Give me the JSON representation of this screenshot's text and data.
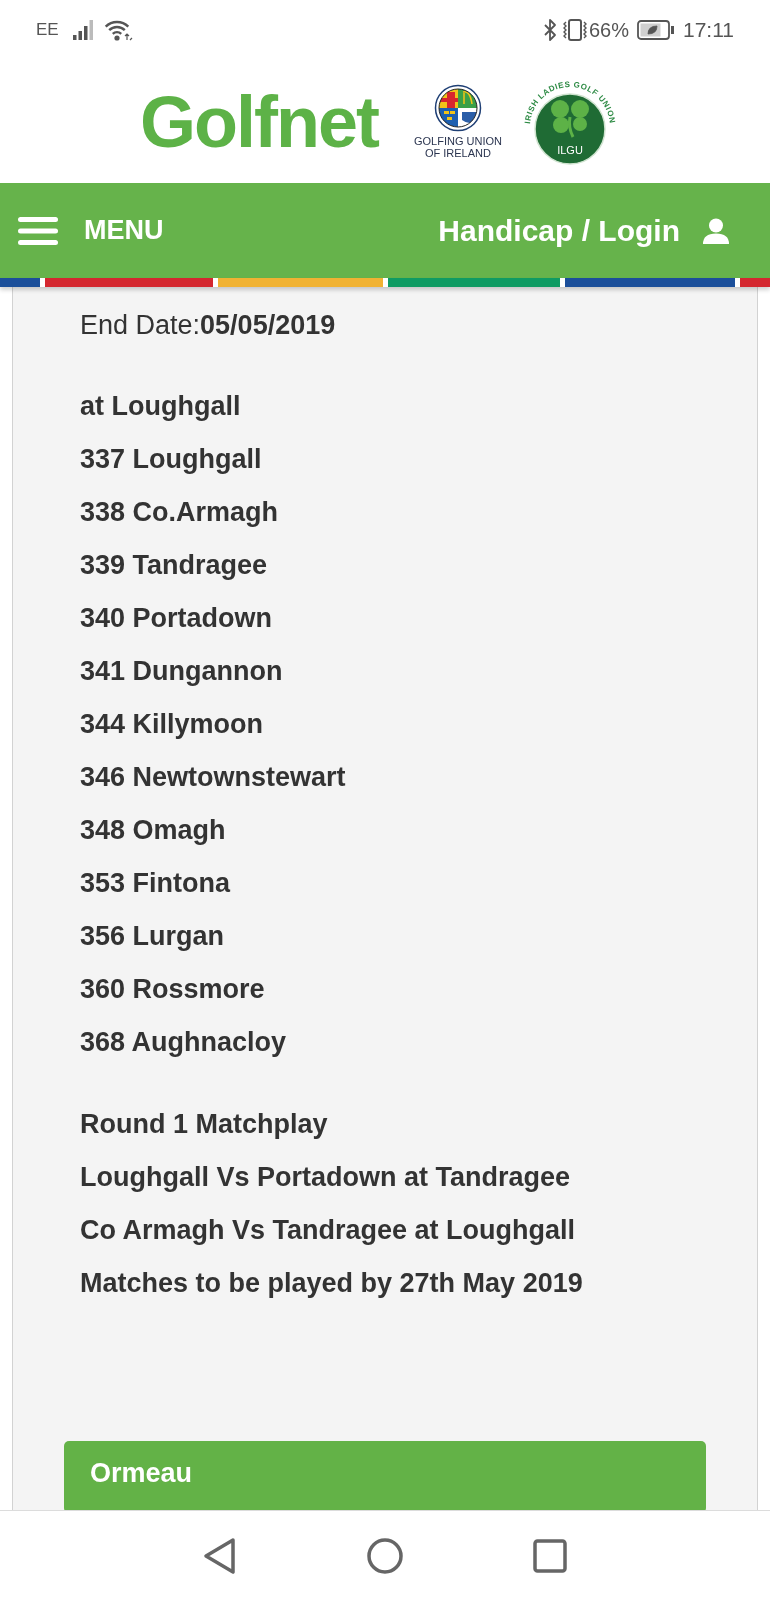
{
  "status_bar": {
    "carrier": "EE",
    "battery": "66%",
    "time": "17:11"
  },
  "header": {
    "logo": "Golfnet",
    "union_caption": "GOLFING UNION OF IRELAND",
    "ladies_arc_text": "IRISH LADIES GOLF UNION",
    "ladies_initials": "ILGU"
  },
  "navbar": {
    "menu": "MENU",
    "login": "Handicap / Login"
  },
  "content": {
    "end_date": "End Date:**05/05/2019**",
    "venue": "at Loughgall",
    "clubs": [
      "337 Loughgall",
      "338 Co.Armagh",
      "339 Tandragee",
      "340 Portadown",
      "341 Dungannon",
      "344 Killymoon",
      "346 Newtownstewart",
      "348 Omagh",
      "353 Fintona",
      "356 Lurgan",
      "360 Rossmore",
      "368 Aughnacloy"
    ],
    "notes": [
      "Round 1 Matchplay",
      "Loughgall Vs Portadown at Tandragee",
      "Co Armagh Vs Tandragee at Loughgall",
      "Matches to be played by 27th May 2019"
    ],
    "next_section": "Ormeau"
  }
}
